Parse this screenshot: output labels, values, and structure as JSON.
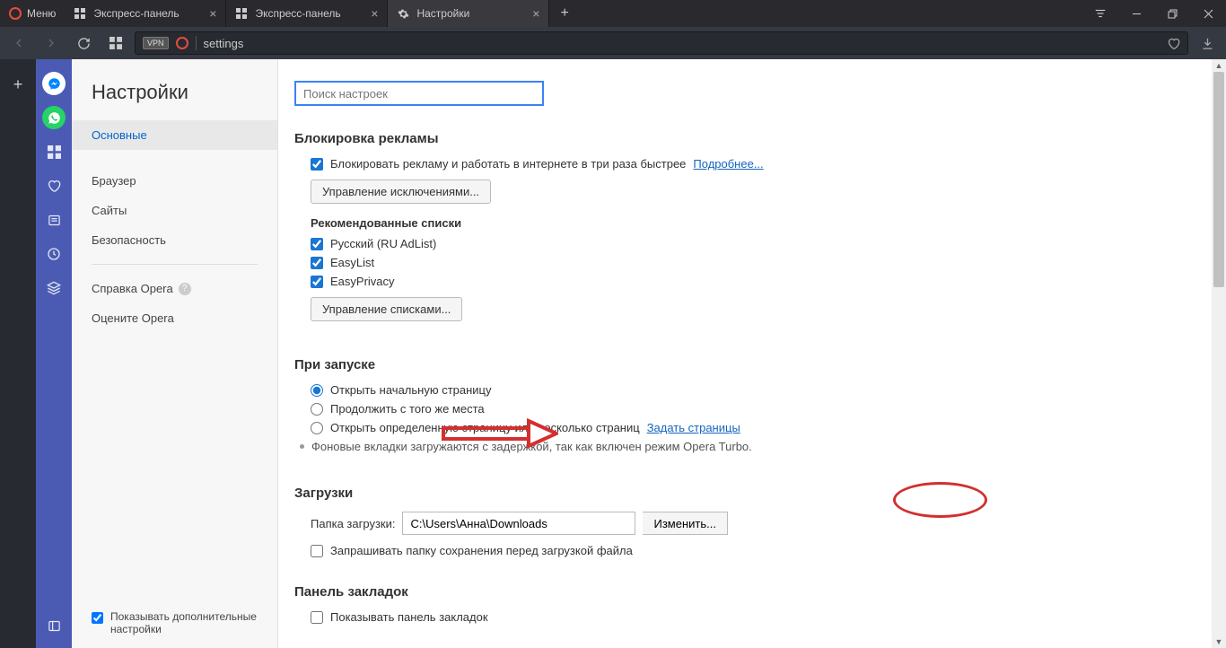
{
  "titlebar": {
    "menu_label": "Меню",
    "tabs": [
      {
        "label": "Экспресс-панель"
      },
      {
        "label": "Экспресс-панель"
      },
      {
        "label": "Настройки"
      }
    ]
  },
  "addressbar": {
    "vpn": "VPN",
    "url": "settings"
  },
  "settings_sidebar": {
    "title": "Настройки",
    "items": {
      "basic": "Основные",
      "browser": "Браузер",
      "sites": "Сайты",
      "security": "Безопасность",
      "help": "Справка Opera",
      "rate": "Оцените Opera"
    },
    "show_advanced": "Показывать дополнительные настройки"
  },
  "content": {
    "search_placeholder": "Поиск настроек",
    "adblock": {
      "title": "Блокировка рекламы",
      "block_label": "Блокировать рекламу и работать в интернете в три раза быстрее",
      "more_link": "Подробнее...",
      "manage_exceptions": "Управление исключениями...",
      "recommended_lists": "Рекомендованные списки",
      "list1": "Русский (RU AdList)",
      "list2": "EasyList",
      "list3": "EasyPrivacy",
      "manage_lists": "Управление списками..."
    },
    "startup": {
      "title": "При запуске",
      "opt1": "Открыть начальную страницу",
      "opt2": "Продолжить с того же места",
      "opt3": "Открыть определенную страницу или несколько страниц",
      "set_pages": "Задать страницы",
      "turbo_note": "Фоновые вкладки загружаются с задержкой, так как включен режим Opera Turbo."
    },
    "downloads": {
      "title": "Загрузки",
      "folder_label": "Папка загрузки:",
      "folder_value": "C:\\Users\\Анна\\Downloads",
      "change": "Изменить...",
      "ask_folder": "Запрашивать папку сохранения перед загрузкой файла"
    },
    "bookmarks": {
      "title": "Панель закладок",
      "show_bar": "Показывать панель закладок"
    }
  }
}
